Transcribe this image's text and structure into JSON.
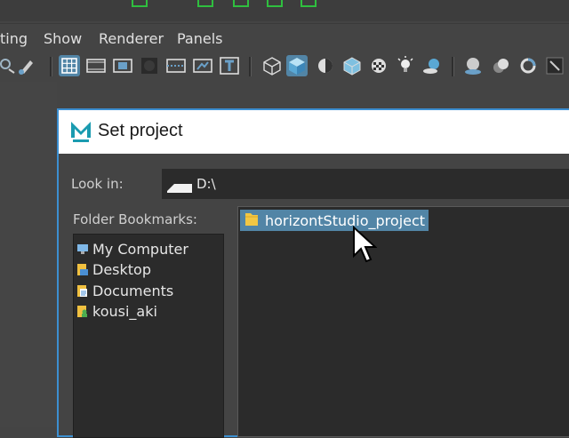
{
  "menubar": {
    "items": [
      "ting",
      "Show",
      "Renderer",
      "Panels"
    ]
  },
  "toolbar": {
    "icons": [
      "lasso-tool-icon",
      "paint-tool-icon",
      "grid-icon",
      "film-gate-icon",
      "resolution-gate-icon",
      "gate-mask-icon",
      "field-chart-icon",
      "safe-action-icon",
      "safe-title-icon",
      "wireframe-cube-icon",
      "smooth-shade-cube-icon",
      "default-material-icon",
      "bounding-box-icon",
      "textured-icon",
      "use-all-lights-icon",
      "shadows-icon",
      "screen-space-ao-icon",
      "motion-blur-icon",
      "antialiasing-icon",
      "isolate-icon"
    ]
  },
  "dialog": {
    "title": "Set project",
    "look_in_label": "Look in:",
    "look_in_value": "D:\\",
    "bookmarks_label": "Folder Bookmarks:",
    "bookmarks": [
      {
        "label": "My Computer",
        "icon": "computer-icon"
      },
      {
        "label": "Desktop",
        "icon": "desktop-icon"
      },
      {
        "label": "Documents",
        "icon": "documents-icon"
      },
      {
        "label": "kousi_aki",
        "icon": "user-folder-icon"
      }
    ],
    "files": [
      {
        "label": "horizontStudio_project",
        "icon": "folder-icon",
        "selected": true
      }
    ]
  },
  "colors": {
    "accent": "#5285a6",
    "dialog_border": "#3c8fd1",
    "titlebar": "#ffffff",
    "panel": "#2b2b2b",
    "background": "#444444"
  }
}
